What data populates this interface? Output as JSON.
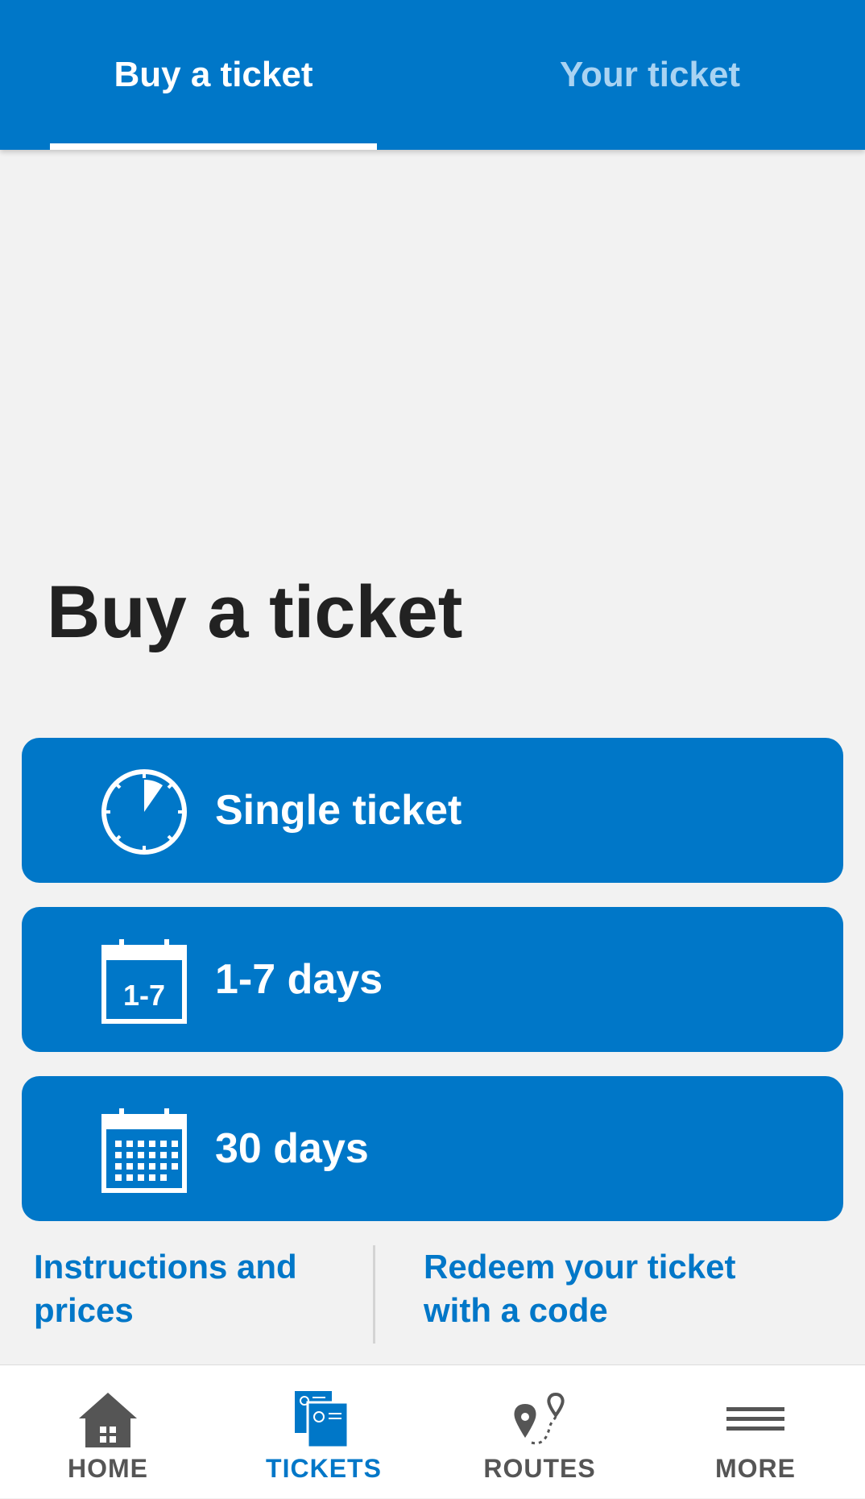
{
  "tabs": [
    {
      "label": "Buy a ticket",
      "active": true
    },
    {
      "label": "Your ticket",
      "active": false
    }
  ],
  "page_title": "Buy a ticket",
  "options": [
    {
      "label": "Single ticket",
      "icon": "stopwatch-icon"
    },
    {
      "label": "1-7 days",
      "icon": "calendar-1-7-icon",
      "icon_text": "1-7"
    },
    {
      "label": "30 days",
      "icon": "calendar-month-icon"
    }
  ],
  "links": {
    "instructions": "Instructions and prices",
    "redeem": "Redeem your ticket with a code"
  },
  "bottom_nav": [
    {
      "label": "HOME",
      "icon": "home-icon",
      "active": false
    },
    {
      "label": "TICKETS",
      "icon": "tickets-icon",
      "active": true
    },
    {
      "label": "ROUTES",
      "icon": "route-pin-icon",
      "active": false
    },
    {
      "label": "MORE",
      "icon": "menu-icon",
      "active": false
    }
  ],
  "colors": {
    "primary": "#0077c8",
    "background": "#f2f2f2",
    "inactive_tab_text": "#a9d3f2",
    "nav_inactive": "#555555"
  }
}
